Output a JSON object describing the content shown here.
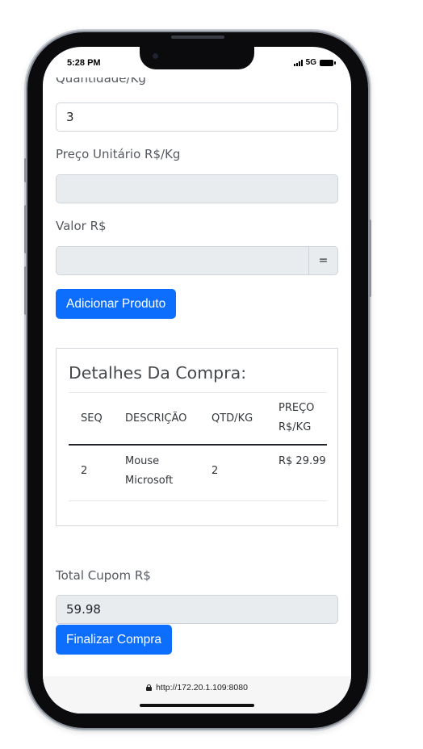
{
  "status_bar": {
    "time": "5:28 PM",
    "network": "5G"
  },
  "form": {
    "quantidade_label": "Quantidade/Kg",
    "quantidade_value": "3",
    "preco_unitario_label": "Preço Unitário R$/Kg",
    "preco_unitario_value": "",
    "valor_label": "Valor R$",
    "valor_value": "",
    "equals_label": "=",
    "add_button": "Adicionar Produto"
  },
  "details": {
    "title": "Detalhes Da Compra:",
    "columns": [
      "SEQ",
      "DESCRIÇÃO",
      "QTD/KG",
      "PREÇO R$/KG"
    ],
    "rows": [
      {
        "seq": "2",
        "descricao": "Mouse Microsoft",
        "qtd": "2",
        "preco": "R$ 29.99"
      }
    ]
  },
  "total": {
    "label": "Total Cupom R$",
    "value": "59.98",
    "finalize_button": "Finalizar Compra"
  },
  "browser": {
    "url": "http://172.20.1.109:8080"
  },
  "colors": {
    "primary": "#0d6efd",
    "disabled_input": "#e9ecef"
  }
}
